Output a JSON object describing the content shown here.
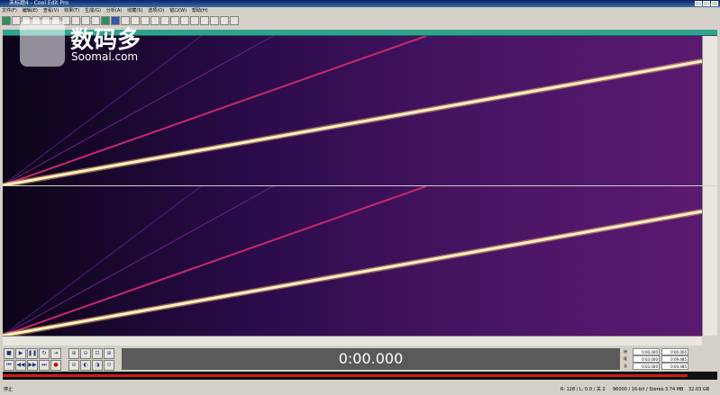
{
  "window": {
    "title": "未标题4 - Cool Edit Pro"
  },
  "menu": [
    "文件(F)",
    "编辑(E)",
    "查看(V)",
    "效果(T)",
    "生成(G)",
    "分析(A)",
    "收藏(S)",
    "选项(O)",
    "窗口(W)",
    "帮助(H)"
  ],
  "time_display": "0:00.000",
  "selection": {
    "labels": [
      "始",
      "尾",
      "长"
    ],
    "begin_values": [
      "0:00.000",
      "0:00.000"
    ],
    "end_values": [
      "0:03.000",
      "0:09.485"
    ],
    "length_values": [
      "0:03.000",
      "0:04.485"
    ]
  },
  "statusbar": {
    "left": "停止",
    "rate": "R: 128 / L: 0.0 / 关 2",
    "format": "96000 / 16-bit / Stereo",
    "size": "3.74 MB",
    "free": "32.03 GB"
  },
  "watermark": {
    "cn": "数码多",
    "en": "Soomal.com"
  },
  "colors": {
    "spectrogram_bg": "#1a0830",
    "sweep": "#fff3c0",
    "harmonic": "#c8286e",
    "time_bg": "#5a5a5a"
  },
  "icons": {
    "transport": [
      "stop-icon",
      "play-icon",
      "pause-icon",
      "play-loop-icon",
      "play-to-end-icon",
      "rewind-start-icon",
      "rewind-icon",
      "fast-forward-icon",
      "forward-end-icon",
      "record-icon"
    ],
    "zoom": [
      "zoom-in-h-icon",
      "zoom-out-h-icon",
      "zoom-full-icon",
      "zoom-in-v-icon",
      "zoom-out-v-icon",
      "zoom-left-icon",
      "zoom-right-icon",
      "zoom-selection-icon"
    ]
  }
}
